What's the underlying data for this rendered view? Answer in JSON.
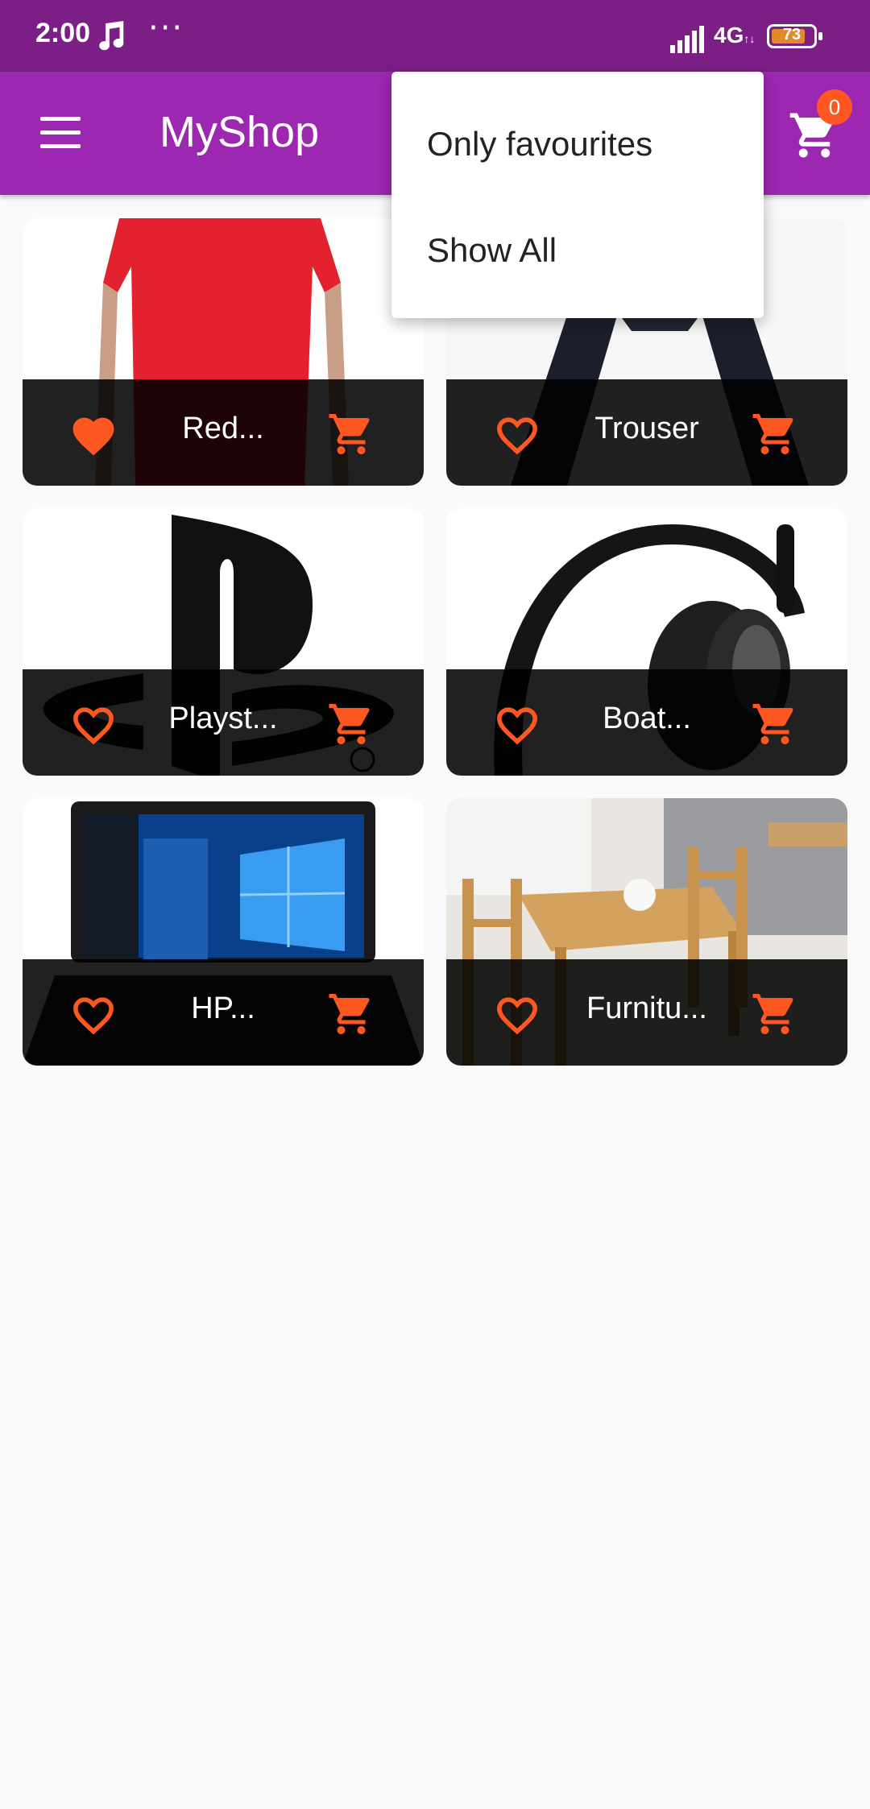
{
  "status_bar": {
    "time": "2:00",
    "more": "···",
    "network": "4G",
    "network_sub": "↑↓",
    "battery": "73"
  },
  "app_bar": {
    "title": "MyShop",
    "menu_icon": "hamburger-menu-icon",
    "cart_icon": "shopping-cart-icon",
    "cart_count": "0"
  },
  "menu": {
    "items": [
      {
        "label": "Only favourites"
      },
      {
        "label": "Show All"
      }
    ]
  },
  "products": [
    {
      "title": "Red...",
      "favorite": true
    },
    {
      "title": "Trouser",
      "favorite": false
    },
    {
      "title": "Playst...",
      "favorite": false
    },
    {
      "title": "Boat...",
      "favorite": false
    },
    {
      "title": "HP...",
      "favorite": false
    },
    {
      "title": "Furnitu...",
      "favorite": false
    }
  ],
  "colors": {
    "status_bar": "#7b1f86",
    "app_bar": "#9c27b0",
    "accent": "#ff5722",
    "tile_footer": "#1a1a1a",
    "background": "#fafafa"
  }
}
